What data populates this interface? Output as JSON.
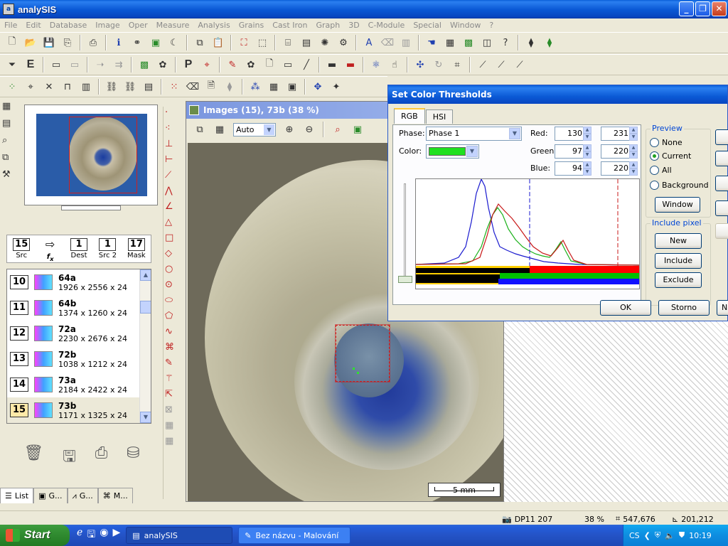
{
  "app": {
    "title": "analySIS",
    "icon": "app-icon"
  },
  "window_buttons": [
    "minimize-icon",
    "restore-icon",
    "close-icon"
  ],
  "menu": [
    "File",
    "Edit",
    "Database",
    "Image",
    "Oper",
    "Measure",
    "Analysis",
    "Grains",
    "Cast Iron",
    "Graph",
    "3D",
    "C-Module",
    "Special",
    "Window",
    "?"
  ],
  "toolbar1": {
    "text_glyphs": []
  },
  "toolbar2": {
    "letter_e": "E",
    "letter_p": "P"
  },
  "slots": [
    {
      "value": "15",
      "label": "Src"
    },
    {
      "value": "",
      "label": "",
      "fx": "f",
      "fx_sub": "x"
    },
    {
      "value": "1",
      "label": "Dest"
    },
    {
      "value": "1",
      "label": "Src 2"
    },
    {
      "value": "17",
      "label": "Mask"
    }
  ],
  "image_list": [
    {
      "num": "10",
      "name": "64a",
      "dims": "1926 x 2556 x 24"
    },
    {
      "num": "11",
      "name": "64b",
      "dims": "1374 x 1260 x 24"
    },
    {
      "num": "12",
      "name": "72a",
      "dims": "2230 x 2676 x 24"
    },
    {
      "num": "13",
      "name": "72b",
      "dims": "1038 x 1212 x 24"
    },
    {
      "num": "14",
      "name": "73a",
      "dims": "2184 x 2422 x 24"
    },
    {
      "num": "15",
      "name": "73b",
      "dims": "1171 x 1325 x 24"
    }
  ],
  "left_tabs": [
    "List",
    "G...",
    "G...",
    "M..."
  ],
  "images_window": {
    "title": "Images (15), 73b (38 %)",
    "zoom": "Auto",
    "scale_bar": "5 mm"
  },
  "dialog": {
    "title": "Set Color Thresholds",
    "tabs": [
      "RGB",
      "HSI"
    ],
    "phase_label": "Phase:",
    "phase_value": "Phase 1",
    "color_label": "Color:",
    "channels": [
      {
        "label": "Red:",
        "low": "130",
        "high": "231"
      },
      {
        "label": "Green:",
        "low": "97",
        "high": "220"
      },
      {
        "label": "Blue:",
        "low": "94",
        "high": "220"
      }
    ],
    "preview": {
      "title": "Preview",
      "options": [
        "None",
        "Current",
        "All",
        "Background"
      ],
      "selected": "Current",
      "window_button": "Window"
    },
    "include_pixel": {
      "title": "Include pixel",
      "buttons": [
        "New",
        "Include",
        "Exclude"
      ]
    },
    "ok": "OK",
    "cancel": "Storno",
    "third_button": "N"
  },
  "statusbar": {
    "camera": "DP11 207",
    "zoom": "38 %",
    "size": "547,676",
    "coords": "201,212"
  },
  "taskbar": {
    "start": "Start",
    "tasks": [
      "analySIS",
      "Bez názvu - Malování"
    ],
    "lang": "CS",
    "clock": "10:19"
  }
}
